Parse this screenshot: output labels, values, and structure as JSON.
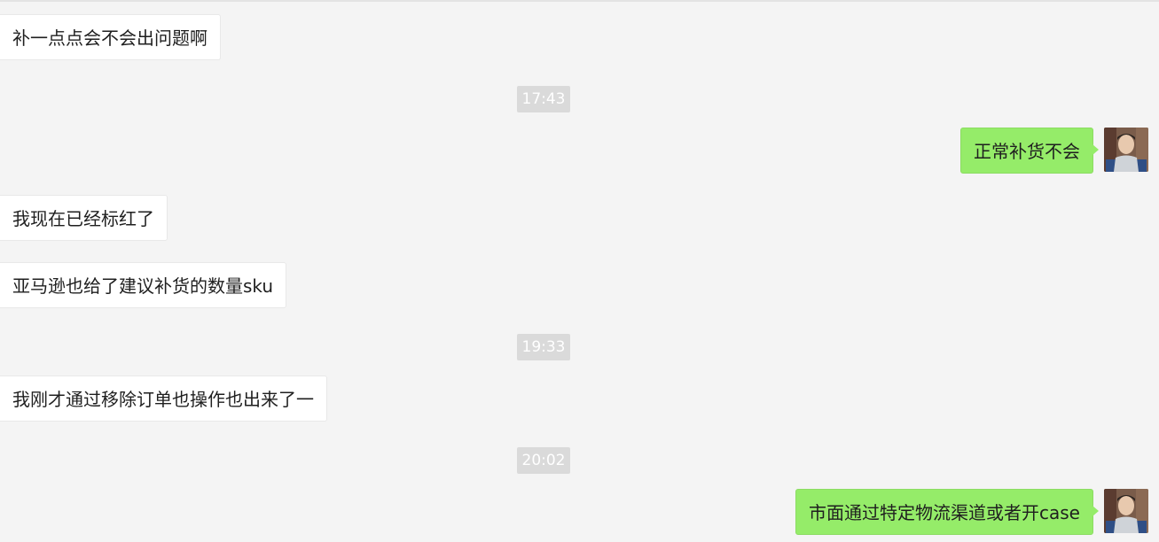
{
  "messages": [
    {
      "text": "补一点点会不会出问题啊"
    },
    {
      "text": "正常补货不会"
    },
    {
      "text": "我现在已经标红了"
    },
    {
      "text": "亚马逊也给了建议补货的数量sku"
    },
    {
      "text": "我刚才通过移除订单也操作也出来了一"
    },
    {
      "text": "市面通过特定物流渠道或者开case"
    }
  ],
  "timestamps": [
    "17:43",
    "19:33",
    "20:02"
  ],
  "colors": {
    "background": "#f4f4f4",
    "incoming_bubble": "#ffffff",
    "outgoing_bubble": "#95ec69",
    "timestamp_bg": "#dadada"
  },
  "icons": [
    "user-avatar"
  ]
}
